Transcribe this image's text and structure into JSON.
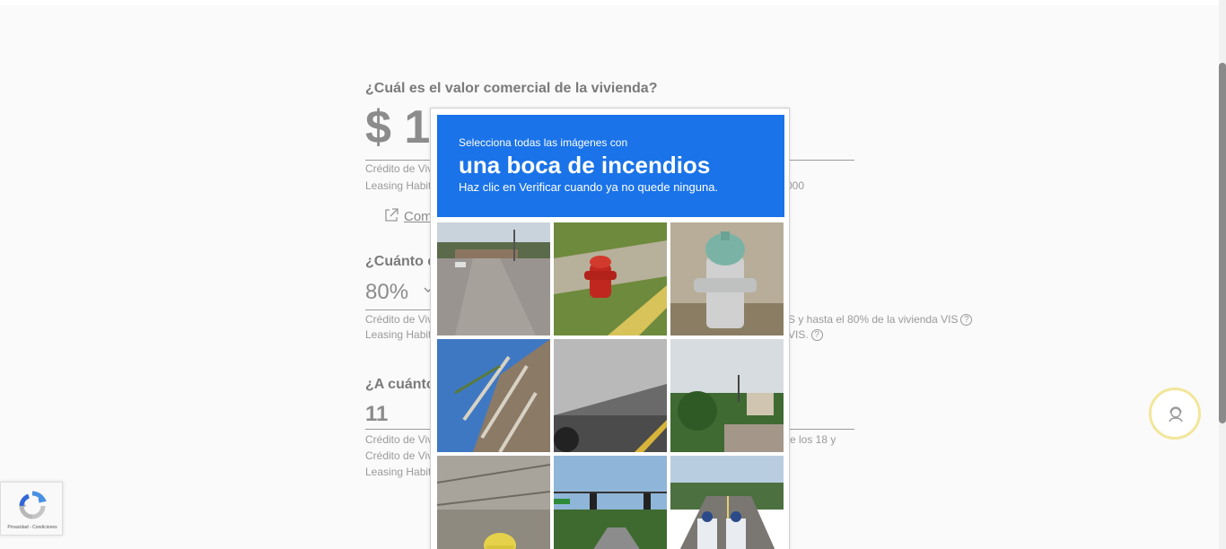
{
  "form": {
    "q1_title": "¿Cuál es el valor comercial de la vivienda?",
    "q1_value": "$ 1",
    "q1_note1": "Crédito de Viv",
    "q1_note2": "Leasing Habit",
    "q1_note2_tail": "000",
    "compare_link": "Com",
    "q2_title": "¿Cuánto d",
    "q2_value": "80%",
    "q2_note1": "Crédito de Viv",
    "q2_note1_tail": "S y hasta el 80% de la vivienda VIS",
    "q2_note2": "Leasing Habit",
    "q2_note2_tail": "VIS.",
    "q3_title": "¿A cuánto",
    "q3_value": "11",
    "q3_note1": "Crédito de Viv",
    "q3_note1_tail": "re los 18 y",
    "q3_note2": "Crédito de Viv",
    "q3_note3": "Leasing Habit",
    "help_glyph": "?"
  },
  "captcha": {
    "instruction_small": "Selecciona todas las imágenes con",
    "instruction_big": "una boca de incendios",
    "instruction_sub": "Haz clic en Verificar cuando ya no quede ninguna.",
    "header_color": "#1a73e8",
    "tiles": [
      "street-parking-lot",
      "red-fire-hydrant",
      "white-fire-hydrant",
      "palm-tree",
      "truck-trailer",
      "houses-street",
      "yellow-fire-hydrant",
      "traffic-light-road",
      "motorcycles-road"
    ]
  },
  "recaptcha_badge": {
    "legal": "Privacidad - Condiciones"
  },
  "icons": {
    "external_link": "external-link-icon",
    "chevron": "chevron-down-icon",
    "chat": "support-agent-icon"
  }
}
